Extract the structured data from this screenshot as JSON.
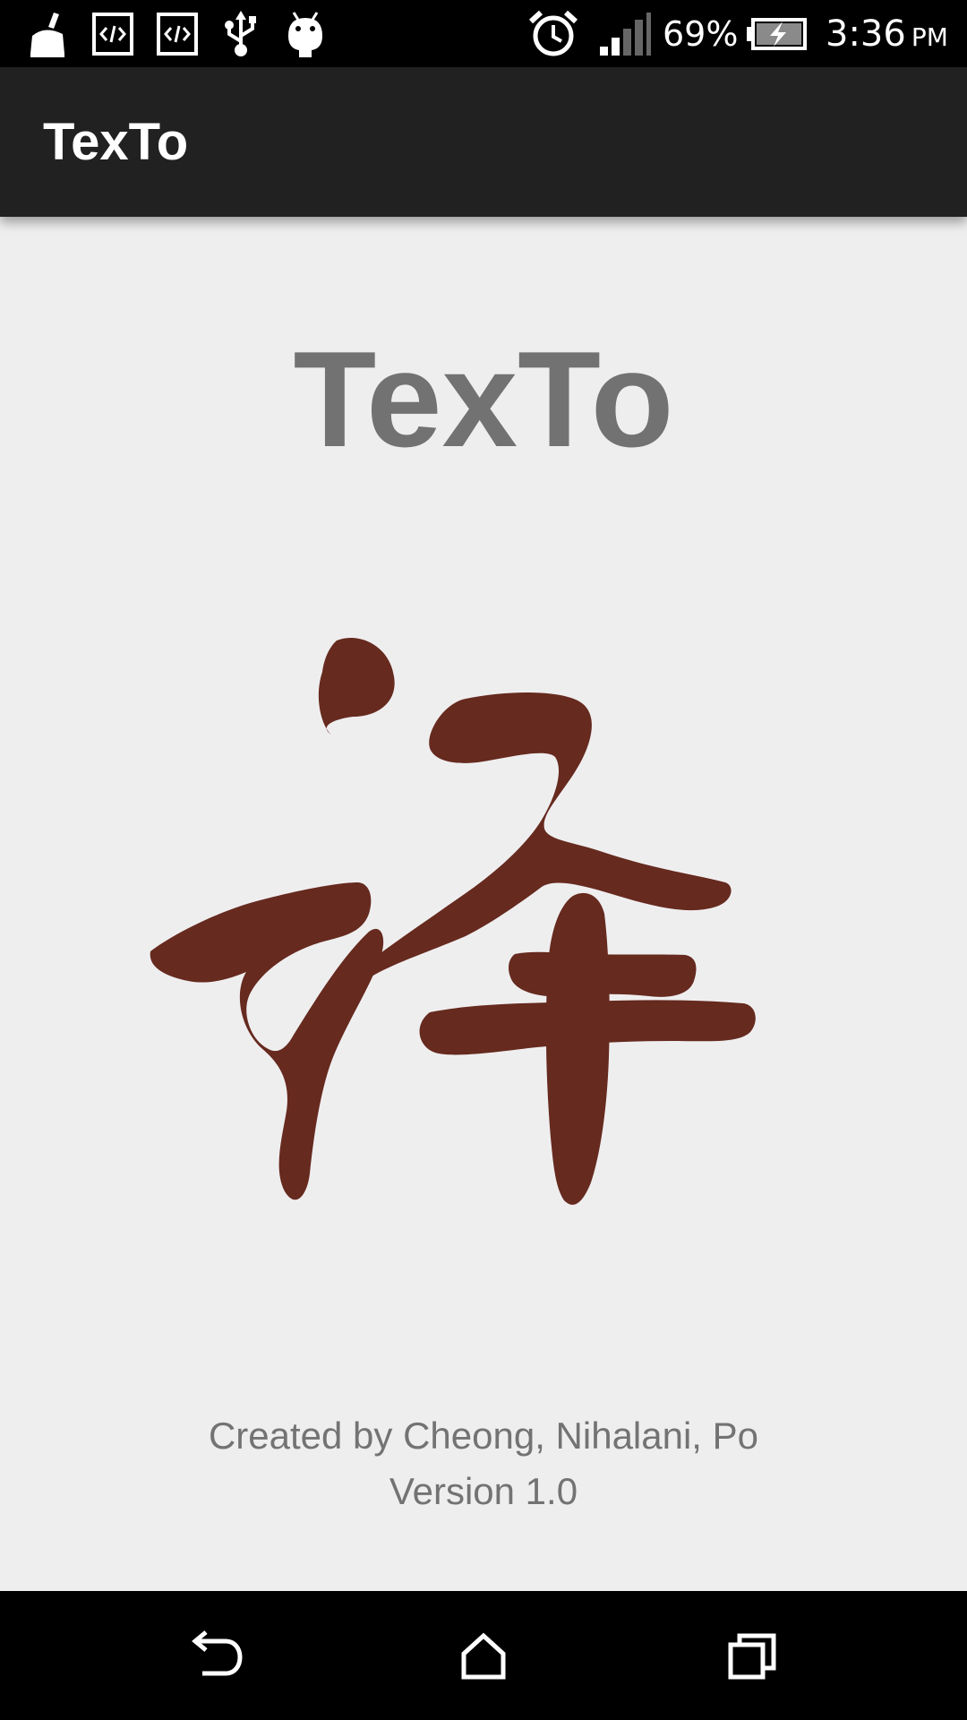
{
  "status_bar": {
    "left_icons": [
      "cleaner-icon",
      "code-icon",
      "code-icon",
      "usb-icon",
      "android-icon"
    ],
    "right_icons": [
      "alarm-icon",
      "signal-icon",
      "battery-charging-icon"
    ],
    "battery_percent": "69%",
    "time": "3:36",
    "ampm": "PM"
  },
  "action_bar": {
    "title": "TexTo"
  },
  "main": {
    "app_name": "TexTo",
    "logo": "chinese-character-translate-logo",
    "logo_color": "#662a1f",
    "credits_line1": "Created by Cheong, Nihalani, Po",
    "credits_line2": "Version 1.0"
  },
  "nav_bar": {
    "buttons": [
      "back-icon",
      "home-icon",
      "recents-icon"
    ]
  }
}
